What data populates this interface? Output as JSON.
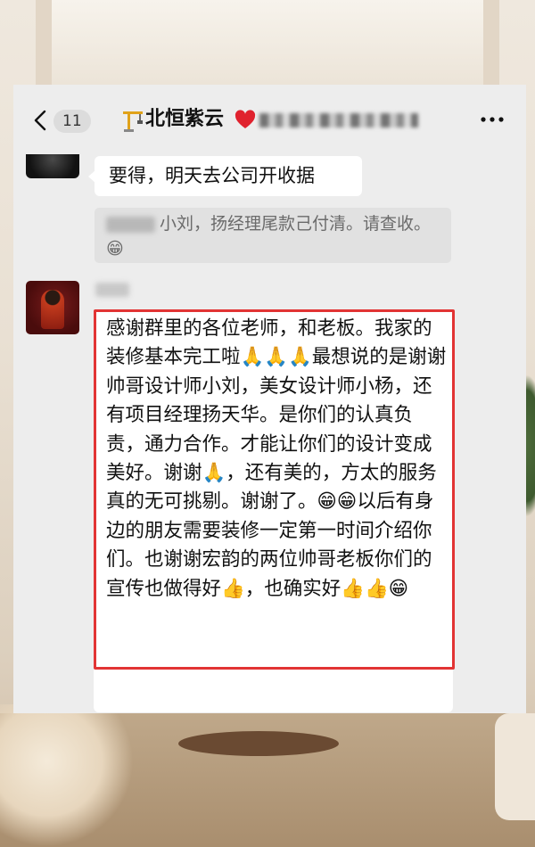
{
  "header": {
    "back_icon": "chevron-left-icon",
    "unread_count": "11",
    "title_icon": "construction-crane-icon",
    "title": "北恒紫云",
    "title_heart_icon": "red-heart-icon",
    "more_icon": "more-dots-icon"
  },
  "messages": [
    {
      "text": "要得，明天去公司开收据"
    },
    {
      "quote_text": "小刘，扬经理尾款己付清。请查收。😁"
    },
    {
      "text": "感谢群里的各位老师，和老板。我家的装修基本完工啦🙏🙏🙏最想说的是谢谢帅哥设计师小刘，美女设计师小杨，还有项目经理扬天华。是你们的认真负责，通力合作。才能让你们的设计变成美好。谢谢🙏，还有美的，方太的服务真的无可挑剔。谢谢了。😁😁以后有身边的朋友需要装修一定第一时间介绍你们。也谢谢宏韵的两位帅哥老板你们的宣传也做得好👍，也确实好👍👍😁"
    }
  ],
  "colors": {
    "highlight_border": "#e23434",
    "bubble_bg": "#ffffff",
    "chat_bg": "#ededed",
    "quote_bg": "#e1e1e1"
  }
}
